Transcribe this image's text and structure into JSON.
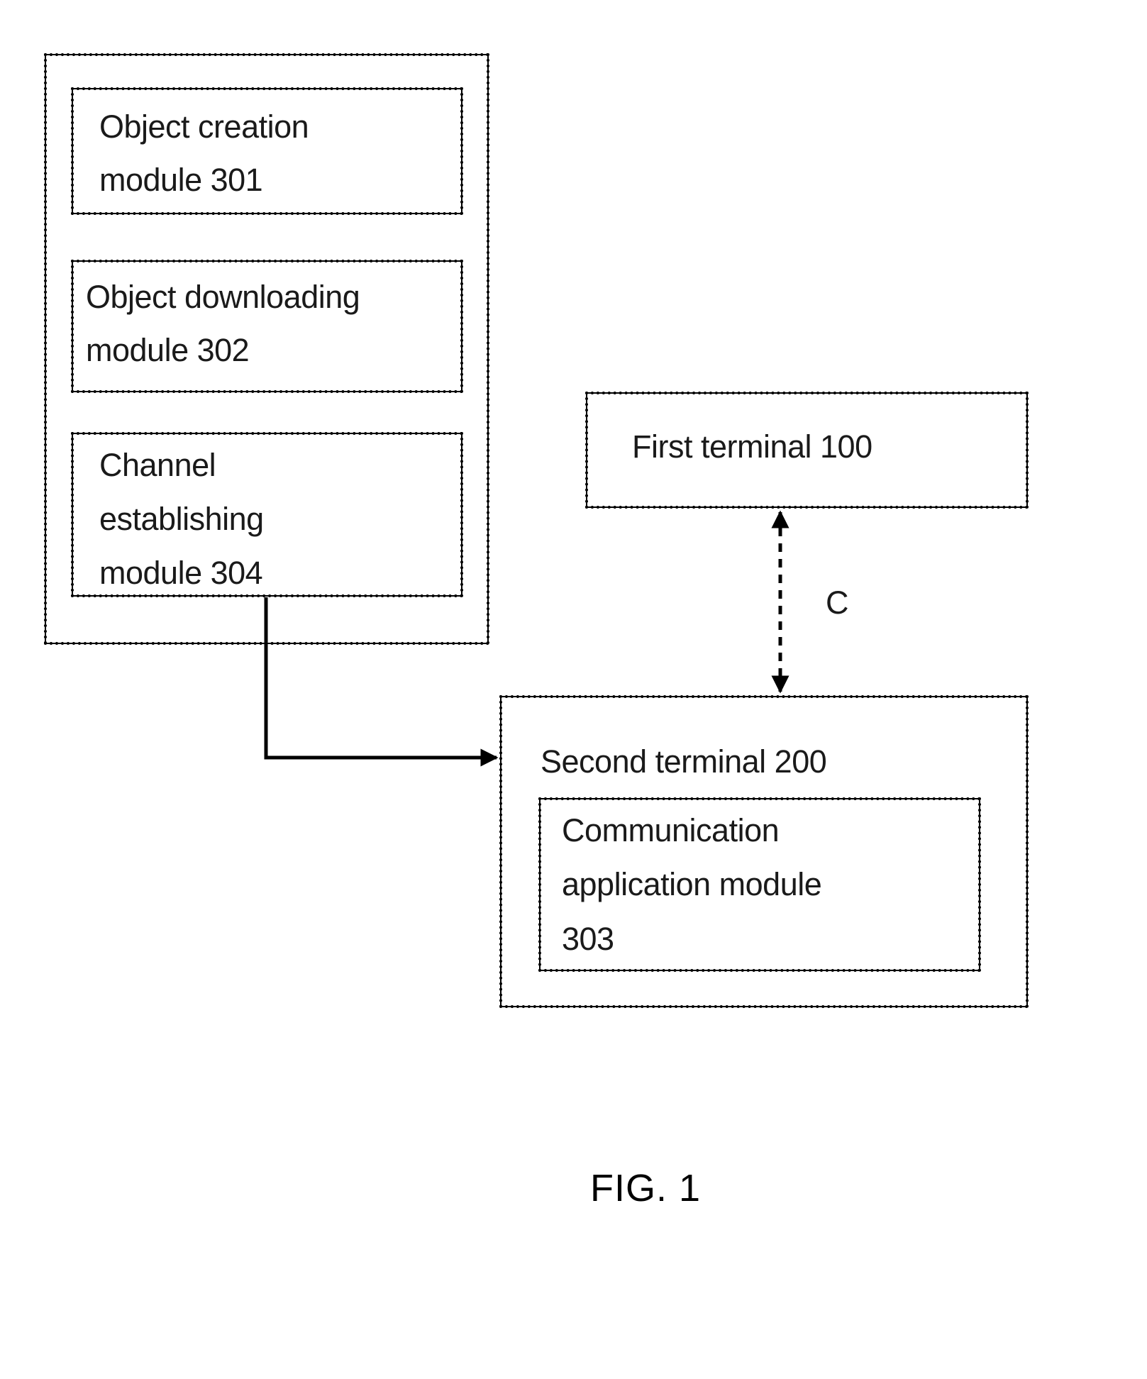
{
  "diagram": {
    "group_outer": {
      "modules": [
        {
          "id": "301",
          "lines": [
            "Object creation",
            "module 301"
          ]
        },
        {
          "id": "302",
          "lines": [
            "Object downloading",
            "module 302"
          ]
        },
        {
          "id": "304",
          "lines": [
            "Channel",
            "establishing",
            "module 304"
          ]
        }
      ]
    },
    "first_terminal": {
      "label": "First terminal 100"
    },
    "second_terminal": {
      "label": "Second terminal 200",
      "inner_module": {
        "id": "303",
        "lines": [
          "Communication",
          "application module",
          "303"
        ]
      }
    },
    "connections": [
      {
        "from": "module 304",
        "to": "Second terminal 200",
        "style": "solid",
        "direction": "one-way"
      },
      {
        "from": "First terminal 100",
        "to": "Second terminal 200",
        "style": "dashed",
        "direction": "two-way",
        "label": "C"
      }
    ],
    "connection_c_label": "C"
  },
  "caption": "FIG. 1"
}
